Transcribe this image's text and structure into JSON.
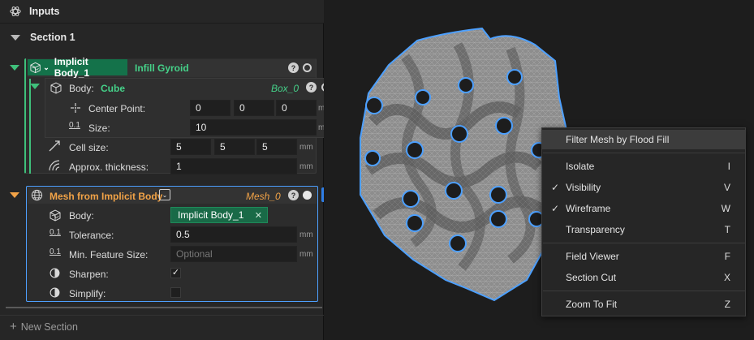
{
  "panel": {
    "title": "Inputs",
    "section_title": "Section 1",
    "new_section_label": "New Section"
  },
  "implicit_body": {
    "name": "Implicit Body_1",
    "type_label": "Infill Gyroid",
    "help": "?",
    "body": {
      "label": "Body:",
      "value": "Cube",
      "output": "Box_0",
      "help": "?",
      "center_point": {
        "label": "Center Point:",
        "x": "0",
        "y": "0",
        "z": "0",
        "unit": "mm"
      },
      "size": {
        "label": "Size:",
        "value": "10",
        "unit": "mm"
      }
    },
    "cell_size": {
      "label": "Cell size:",
      "x": "5",
      "y": "5",
      "z": "5",
      "unit": "mm"
    },
    "approx_thickness": {
      "label": "Approx. thickness:",
      "value": "1",
      "unit": "mm"
    }
  },
  "mesh_node": {
    "title": "Mesh from Implicit Body",
    "output": "Mesh_0",
    "help": "?",
    "body": {
      "label": "Body:",
      "value": "Implicit Body_1",
      "remove": "✕"
    },
    "tolerance": {
      "label": "Tolerance:",
      "value": "0.5",
      "unit": "mm"
    },
    "min_feature_size": {
      "label": "Min. Feature Size:",
      "placeholder": "Optional",
      "unit": "mm"
    },
    "sharpen": {
      "label": "Sharpen:",
      "checked": true,
      "mark": "✓"
    },
    "simplify": {
      "label": "Simplify:",
      "checked": false
    }
  },
  "plus_button": "+",
  "context_menu": {
    "items": [
      {
        "label": "Filter Mesh by Flood Fill",
        "key": "",
        "checked": false,
        "highlighted": true
      },
      {
        "label": "Isolate",
        "key": "I",
        "checked": false
      },
      {
        "label": "Visibility",
        "key": "V",
        "checked": true
      },
      {
        "label": "Wireframe",
        "key": "W",
        "checked": true
      },
      {
        "label": "Transparency",
        "key": "T",
        "checked": false
      },
      {
        "label": "Field Viewer",
        "key": "F",
        "checked": false
      },
      {
        "label": "Section Cut",
        "key": "X",
        "checked": false
      },
      {
        "label": "Zoom To Fit",
        "key": "Z",
        "checked": false
      }
    ],
    "check_mark": "✓"
  },
  "colors": {
    "accent_green": "#45d189",
    "accent_orange": "#f2a347",
    "selection_blue": "#4da0ff",
    "panel_bg": "#262626"
  }
}
